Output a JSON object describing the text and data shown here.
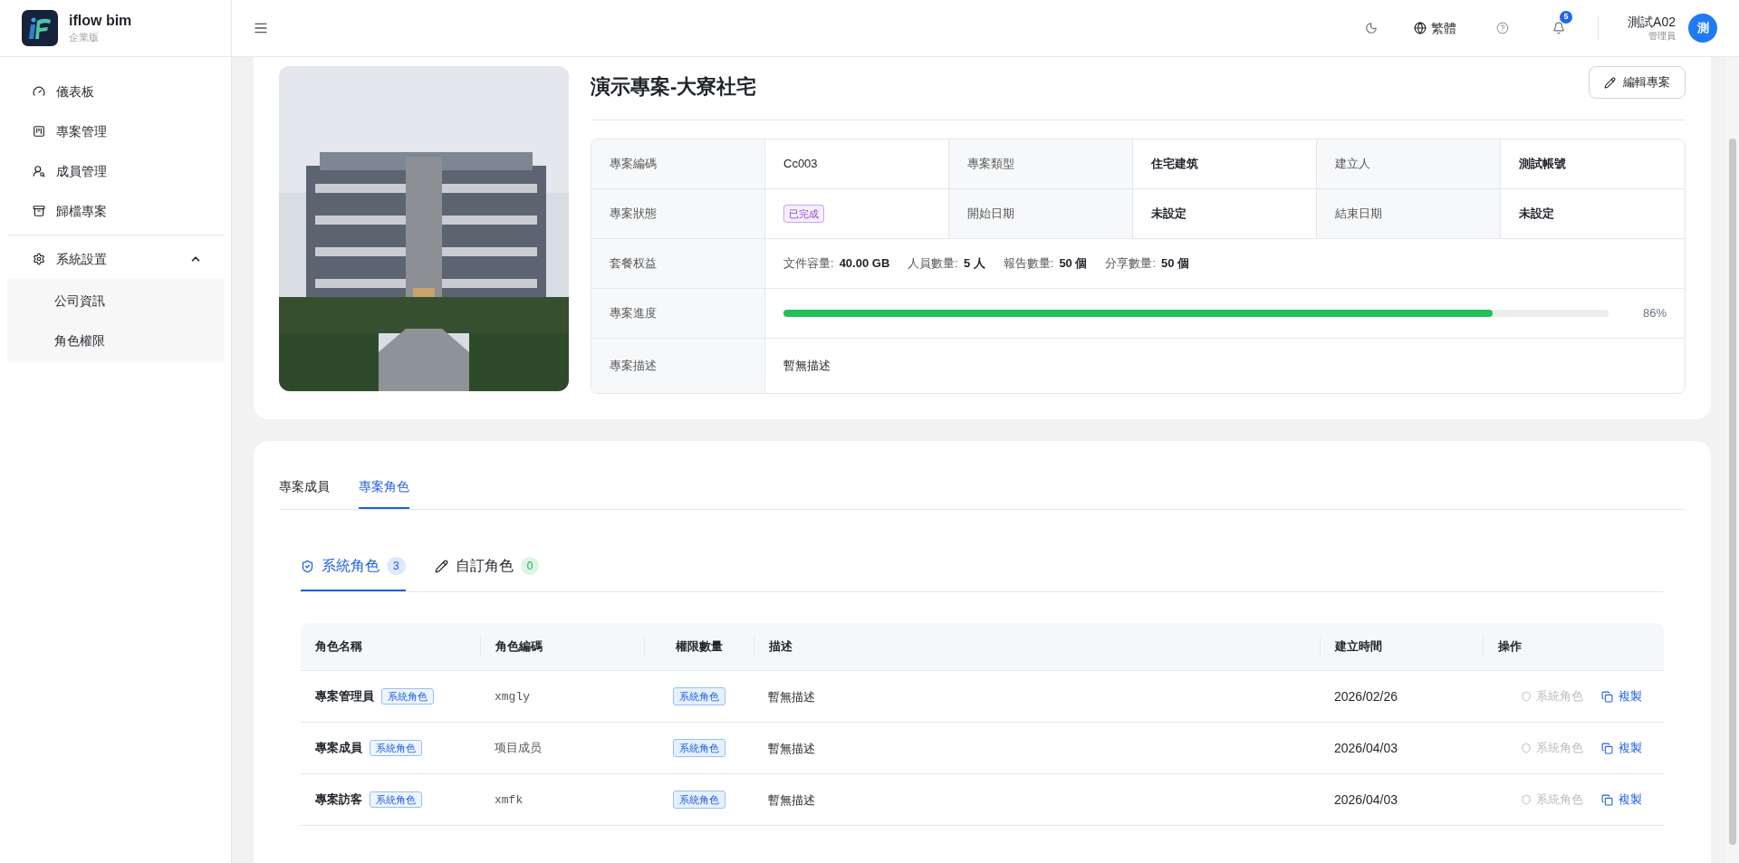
{
  "brand": {
    "name": "iflow bim",
    "edition": "企業版"
  },
  "header": {
    "language": "繁體",
    "notifications": "5",
    "user": {
      "name": "測試A02",
      "role": "管理員",
      "avatar": "測"
    }
  },
  "sidebar": {
    "items": [
      {
        "label": "儀表板"
      },
      {
        "label": "專案管理"
      },
      {
        "label": "成員管理"
      },
      {
        "label": "歸檔專案"
      }
    ],
    "group": {
      "label": "系統設置",
      "expanded": true,
      "children": [
        {
          "label": "公司資訊"
        },
        {
          "label": "角色權限"
        }
      ]
    }
  },
  "project": {
    "title": "演示專案-大寮社宅",
    "edit_button": "編輯專案",
    "info_rows": [
      {
        "kind": "pairs",
        "pairs": [
          {
            "label": "專案編碼",
            "value": "Cc003",
            "kind": "plain"
          },
          {
            "label": "專案類型",
            "value": "住宅建筑",
            "kind": "strong"
          },
          {
            "label": "建立人",
            "value": "測試帳號",
            "kind": "strong"
          }
        ]
      },
      {
        "kind": "pairs",
        "pairs": [
          {
            "label": "專案狀態",
            "value": "已完成",
            "kind": "badge"
          },
          {
            "label": "開始日期",
            "value": "未設定",
            "kind": "strong"
          },
          {
            "label": "結束日期",
            "value": "未設定",
            "kind": "strong"
          }
        ]
      },
      {
        "kind": "quota",
        "label": "套餐权益",
        "items": [
          {
            "label": "文件容量:",
            "value": "40.00 GB"
          },
          {
            "label": "人員數量:",
            "value": "5 人"
          },
          {
            "label": "報告數量:",
            "value": "50 個"
          },
          {
            "label": "分享數量:",
            "value": "50 個"
          }
        ]
      },
      {
        "kind": "progress",
        "label": "專案進度",
        "level": 0.86,
        "reading": "86%"
      },
      {
        "kind": "text",
        "label": "專案描述",
        "value": "暫無描述"
      }
    ]
  },
  "tabs": [
    {
      "label": "專案成員",
      "selected": false
    },
    {
      "label": "專案角色",
      "selected": true
    }
  ],
  "role_tabs": [
    {
      "kind": "system",
      "label": "系統角色",
      "count": "3",
      "selected": true
    },
    {
      "kind": "custom",
      "label": "自訂角色",
      "count": "0",
      "selected": false
    }
  ],
  "table": {
    "columns": [
      "角色名稱",
      "角色編碼",
      "權限數量",
      "描述",
      "建立時間",
      "操作"
    ],
    "rows": [
      {
        "name": "專案管理員",
        "tag": "系統角色",
        "code": "xmgly",
        "permissions": "系統角色",
        "description": "暫無描述",
        "created": "2026/02/26",
        "status": "系統角色",
        "copy": "複製"
      },
      {
        "name": "專案成員",
        "tag": "系統角色",
        "code": "项目成员",
        "permissions": "系統角色",
        "description": "暫無描述",
        "created": "2026/04/03",
        "status": "系統角色",
        "copy": "複製"
      },
      {
        "name": "專案訪客",
        "tag": "系統角色",
        "code": "xmfk",
        "permissions": "系統角色",
        "description": "暫無描述",
        "created": "2026/04/03",
        "status": "系統角色",
        "copy": "複製"
      }
    ]
  }
}
